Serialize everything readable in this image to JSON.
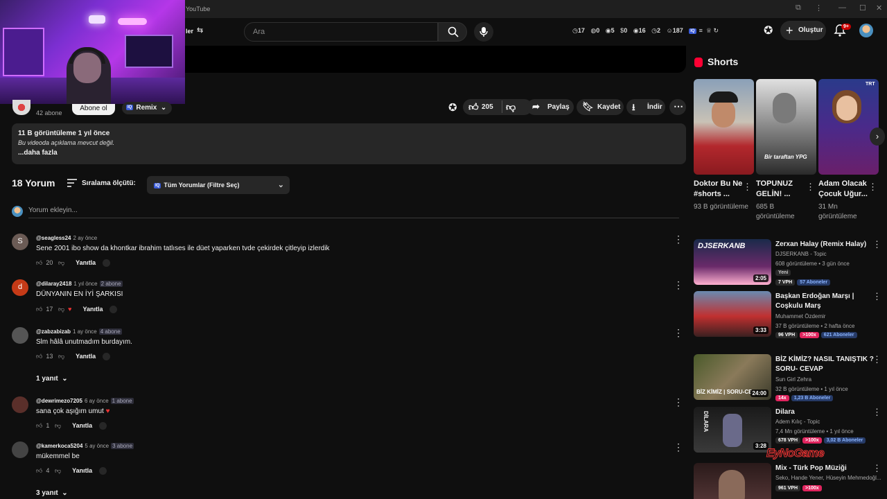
{
  "window": {
    "title": "YouTube"
  },
  "header": {
    "search_placeholder": "Ara",
    "filter_label": "ler",
    "stats": [
      "17",
      "0",
      "5",
      "0",
      "16",
      "2",
      "187"
    ],
    "create_label": "Oluştur",
    "notif_badge": "9+"
  },
  "video": {
    "subs": "42 abone",
    "subscribe_label": "Abone ol",
    "remix_label": "Remix",
    "likes": "205",
    "share_label": "Paylaş",
    "save_label": "Kaydet",
    "download_label": "İndir",
    "description": {
      "stats": "11 B görüntüleme  1 yıl önce",
      "text": "Bu videoda açıklama mevcut değil.",
      "more": "...daha fazla"
    }
  },
  "comments": {
    "count": "18 Yorum",
    "sort_label": "Sıralama ölçütü:",
    "filter_label": "Tüm Yorumlar (Filtre Seç)",
    "add_placeholder": "Yorum ekleyin...",
    "reply_label": "Yanıtla",
    "items": [
      {
        "user": "@seagless24",
        "time": "2 ay önce",
        "badge": "",
        "text": "Sene 2001 ibo show da khontkar ibrahim tatlıses ile düet yaparken tvde çekirdek çitleyip izlerdik",
        "likes": "20",
        "avatar_letter": "S",
        "avatar_color": "#6b5b55"
      },
      {
        "user": "@dilaray2418",
        "time": "1 yıl önce",
        "badge": "2 abone",
        "text": "DÜNYANIN EN İYİ ŞARKISI",
        "likes": "17",
        "avatar_letter": "d",
        "avatar_color": "#c53a17"
      },
      {
        "user": "@zabzabizab",
        "time": "1 ay önce",
        "badge": "4 abone",
        "text": "Slm hâlâ unutmadım burdayım.",
        "likes": "13",
        "avatar_letter": "",
        "avatar_color": "#555555",
        "replies": "1 yanıt"
      },
      {
        "user": "@dewrimezo7205",
        "time": "6 ay önce",
        "badge": "1 abone",
        "text": "sana çok aşığım umut",
        "likes": "1",
        "avatar_letter": "",
        "avatar_color": "#5a2f2a"
      },
      {
        "user": "@kamerkoca5204",
        "time": "5 ay önce",
        "badge": "3 abone",
        "text": "mükemmel be",
        "likes": "4",
        "avatar_letter": "",
        "avatar_color": "#444444",
        "replies": "3 yanıt"
      }
    ]
  },
  "sidebar": {
    "shorts_title": "Shorts",
    "shorts": [
      {
        "title": "Doktor Bu Ne #shorts ...",
        "views": "93 B görüntüleme",
        "overlay": ""
      },
      {
        "title": "TOPUNUZ GELİN! ...",
        "views": "685 B görüntüleme",
        "overlay": "Bir taraftan YPG"
      },
      {
        "title": "Adam Olacak Çocuk Uğur...",
        "views": "31 Mn görüntüleme",
        "overlay": "TRT"
      }
    ],
    "videos": [
      {
        "title": "Zerxan Halay (Remix Halay)",
        "channel": "DJSERKANB - Topic",
        "views": "608 görüntüleme • 3 gün önce",
        "duration": "2:05",
        "thumb_text": "DJSERKANB",
        "badges": [
          "Yeni",
          "7 VPH",
          "57 Aboneler"
        ]
      },
      {
        "title": "Başkan Erdoğan Marşı | Coşkulu Marş",
        "channel": "Muhammet Özdemir",
        "views": "37 B görüntüleme • 2 hafta önce",
        "duration": "3:33",
        "thumb_text": "",
        "badges": [
          "96 VPH",
          ">100x",
          "621 Aboneler"
        ]
      },
      {
        "title": "BİZ KİMİZ? NASIL TANIŞTIK ? SORU- CEVAP",
        "channel": "Sun Girl Zehra",
        "views": "32 B görüntüleme • 1 yıl önce",
        "duration": "24:00",
        "thumb_text": "BİZ KİMİZ | SORU-CE",
        "badges": [
          "14x",
          "1,23 B Aboneler"
        ]
      },
      {
        "title": "Dilara",
        "channel": "Adem Kılıç - Topic",
        "views": "7,4 Mn görüntüleme • 1 yıl önce",
        "duration": "3:28",
        "thumb_text": "DİLARA",
        "badges": [
          "678 VPH",
          ">100x",
          "3,02 B Aboneler"
        ]
      },
      {
        "title": "Mix - Türk Pop Müziği",
        "channel": "Seko, Hande Yener, Hüseyin Mehmedoğl...",
        "views": "",
        "duration": "",
        "thumb_text": "",
        "badges": [
          "961 VPH",
          ">100x"
        ]
      }
    ]
  },
  "watermark": "EyNoGame",
  "colors": {
    "accent": "#ff0033",
    "badge_red": "#e0245e",
    "badge_blue": "#263a66"
  }
}
